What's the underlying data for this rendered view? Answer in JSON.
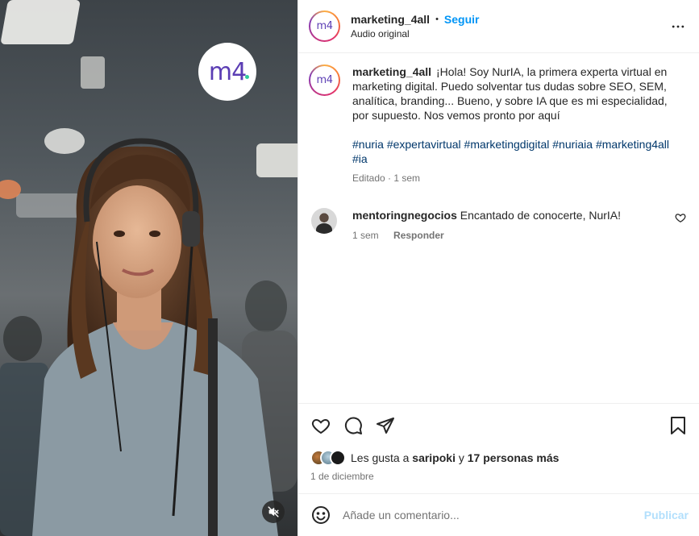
{
  "post": {
    "username": "marketing_4all",
    "follow_label": "Seguir",
    "separator": "•",
    "audio_label": "Audio original",
    "avatar_text": "m4",
    "video_logo_text": "m4"
  },
  "caption": {
    "username": "marketing_4all",
    "text": "¡Hola! Soy NurIA, la primera experta virtual en marketing digital. Puedo solventar tus dudas sobre SEO, SEM, analítica, branding... Bueno, y sobre IA que es mi especialidad, por supuesto. Nos vemos pronto por aquí",
    "hashtags": [
      "#nuria",
      "#expertavirtual",
      "#marketingdigital",
      "#nuriaia",
      "#marketing4all",
      "#ia"
    ],
    "meta": "Editado · 1 sem"
  },
  "comment": {
    "username": "mentoringnegocios",
    "text": "Encantado de conocerte, NurIA!",
    "time": "1 sem",
    "reply_label": "Responder"
  },
  "likes": {
    "prefix": "Les gusta a",
    "first_user": "saripoki",
    "connector": "y",
    "others": "17 personas más",
    "date": "1 de diciembre"
  },
  "add_comment": {
    "placeholder": "Añade un comentario...",
    "publish_label": "Publicar"
  },
  "colors": {
    "accent": "#0095f6",
    "hashtag": "#00376b",
    "publish_disabled": "#b2dffc",
    "secondary_text": "#737373"
  },
  "icons": [
    "more-options-icon",
    "heart-icon",
    "comment-icon",
    "share-icon",
    "bookmark-icon",
    "emoji-icon",
    "mute-icon"
  ]
}
